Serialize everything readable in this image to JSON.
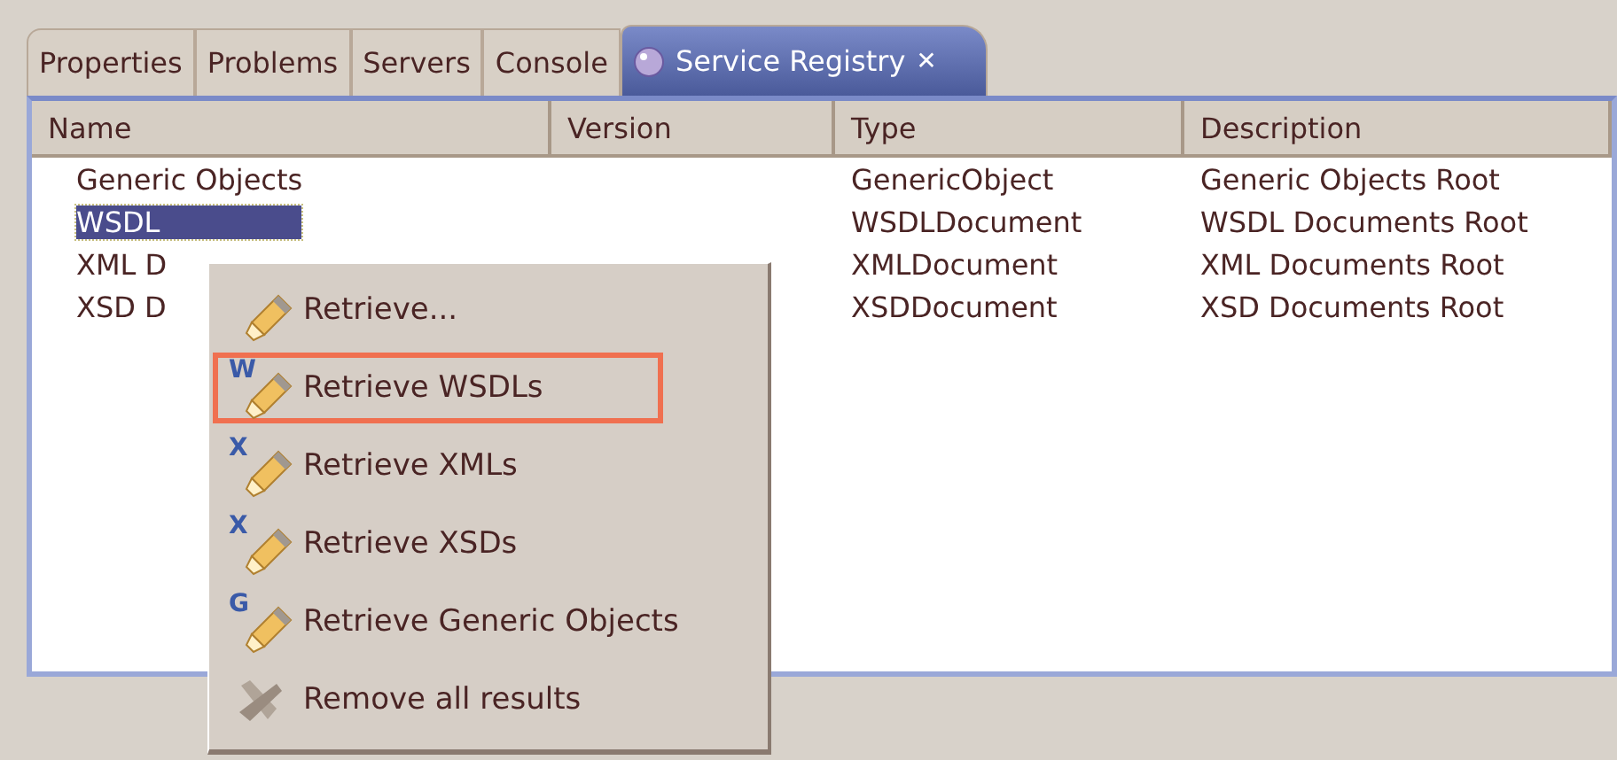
{
  "tabs": [
    {
      "label": "Properties",
      "selected": false,
      "closable": false
    },
    {
      "label": "Problems",
      "selected": false,
      "closable": false
    },
    {
      "label": "Servers",
      "selected": false,
      "closable": false
    },
    {
      "label": "Console",
      "selected": false,
      "closable": false
    },
    {
      "label": "Service Registry",
      "selected": true,
      "closable": true,
      "close_glyph": "✕"
    }
  ],
  "table": {
    "columns": [
      "Name",
      "Version",
      "Type",
      "Description"
    ],
    "rows": [
      {
        "name": "Generic Objects",
        "type": "GenericObject",
        "description": "Generic Objects Root",
        "selected": false
      },
      {
        "name": "WSDL",
        "type": "WSDLDocument",
        "description": "WSDL Documents Root",
        "selected": true
      },
      {
        "name": "XML D",
        "type": "XMLDocument",
        "description": "XML Documents Root",
        "selected": false
      },
      {
        "name": "XSD D",
        "type": "XSDDocument",
        "description": "XSD Documents Root",
        "selected": false
      }
    ]
  },
  "context_menu": {
    "items": [
      {
        "label": "Retrieve...",
        "kind": "retrieve",
        "highlighted": false
      },
      {
        "label": "Retrieve WSDLs",
        "kind": "retrieve",
        "badge": "W",
        "highlighted": true
      },
      {
        "label": "Retrieve XMLs",
        "kind": "retrieve",
        "badge": "X",
        "highlighted": false
      },
      {
        "label": "Retrieve XSDs",
        "kind": "retrieve",
        "badge": "X",
        "highlighted": false
      },
      {
        "label": "Retrieve Generic Objects",
        "kind": "retrieve",
        "badge": "G",
        "highlighted": false
      },
      {
        "label": "Remove all results",
        "kind": "remove",
        "highlighted": false
      }
    ]
  }
}
